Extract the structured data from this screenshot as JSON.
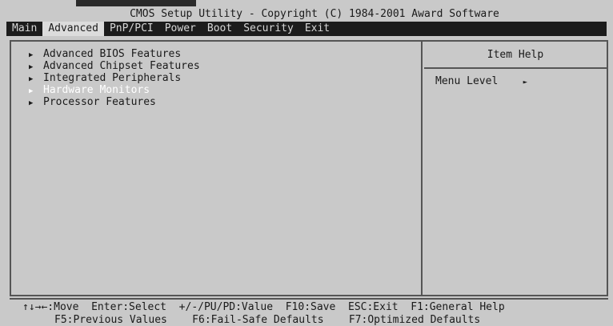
{
  "window": {
    "title": "CMOS Setup Utility - Copyright (C) 1984-2001 Award Software"
  },
  "menubar": {
    "items": [
      {
        "label": "Main",
        "active": false
      },
      {
        "label": "Advanced",
        "active": true
      },
      {
        "label": "PnP/PCI",
        "active": false
      },
      {
        "label": "Power",
        "active": false
      },
      {
        "label": "Boot",
        "active": false
      },
      {
        "label": "Security",
        "active": false
      },
      {
        "label": "Exit",
        "active": false
      }
    ]
  },
  "list": {
    "items": [
      {
        "label": "Advanced BIOS Features",
        "icon": "triangle-right-icon"
      },
      {
        "label": "Advanced Chipset Features",
        "icon": "triangle-right-icon"
      },
      {
        "label": "Integrated Peripherals",
        "icon": "triangle-right-icon"
      },
      {
        "label": "Hardware Monitors",
        "icon": "triangle-right-icon",
        "selected": true
      },
      {
        "label": "Processor Features",
        "icon": "triangle-right-icon"
      }
    ]
  },
  "help": {
    "title": "Item Help",
    "menu_level_label": "Menu Level",
    "menu_level_marker": "►"
  },
  "footer": {
    "line1": "↑↓→←:Move  Enter:Select  +/-/PU/PD:Value  F10:Save  ESC:Exit  F1:General Help",
    "line2": "F5:Previous Values    F6:Fail-Safe Defaults    F7:Optimized Defaults"
  },
  "colors": {
    "background": "#c9c9c9",
    "menubar": "#1c1c1c",
    "selected_text": "#ffffff"
  }
}
